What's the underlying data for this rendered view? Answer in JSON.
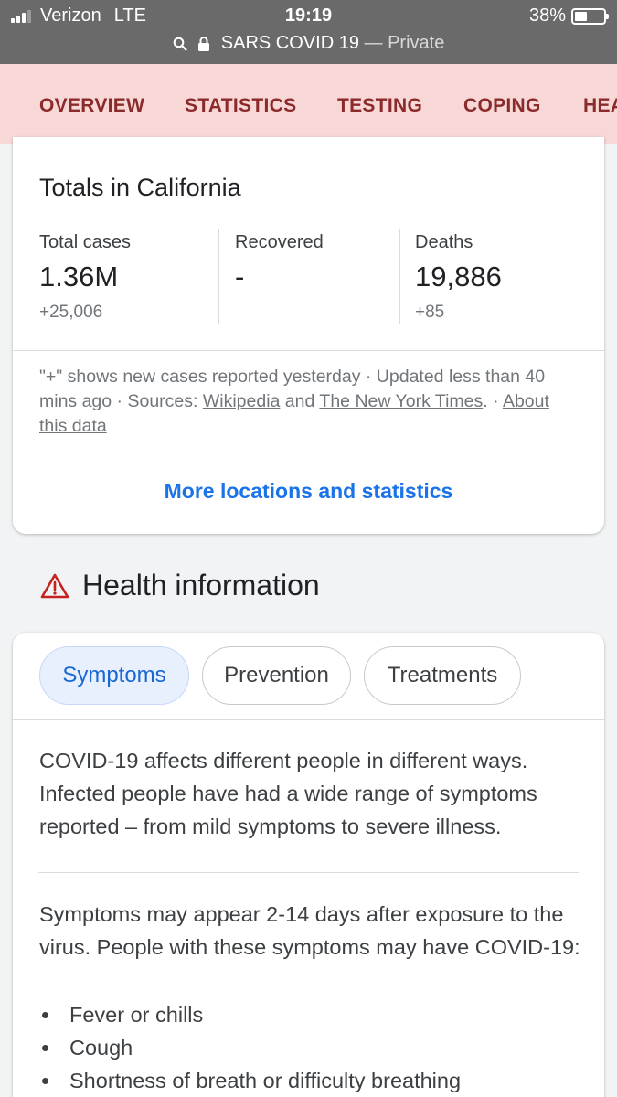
{
  "status_bar": {
    "carrier": "Verizon",
    "network": "LTE",
    "time": "19:19",
    "battery": "38%",
    "battery_level": 0.38
  },
  "url_bar": {
    "title": "SARS COVID 19",
    "separator": "—",
    "mode": "Private"
  },
  "tabs": [
    {
      "label": "OVERVIEW",
      "active": true
    },
    {
      "label": "STATISTICS"
    },
    {
      "label": "TESTING"
    },
    {
      "label": "COPING"
    },
    {
      "label": "HEA"
    }
  ],
  "totals": {
    "title": "Totals in California",
    "stats": [
      {
        "label": "Total cases",
        "value": "1.36M",
        "delta": "+25,006"
      },
      {
        "label": "Recovered",
        "value": "-",
        "delta": ""
      },
      {
        "label": "Deaths",
        "value": "19,886",
        "delta": "+85"
      }
    ],
    "footnote": {
      "line1": "\"+\" shows new cases reported yesterday · Updated less than 40 mins ago",
      "sep": " · ",
      "sources_prefix": "Sources: ",
      "source1": "Wikipedia",
      "and": " and ",
      "source2": "The New York Times",
      "period": ".",
      "about": "About this data"
    },
    "more_link": "More locations and statistics"
  },
  "health": {
    "title": "Health information",
    "icon": "warning-icon",
    "chips": [
      "Symptoms",
      "Prevention",
      "Treatments"
    ],
    "intro": "COVID-19 affects different people in different ways. Infected people have had a wide range of symptoms reported – from mild symptoms to severe illness.",
    "symptoms_intro": "Symptoms may appear 2-14 days after exposure to the virus. People with these symptoms may have COVID-19:",
    "symptoms": [
      "Fever or chills",
      "Cough",
      "Shortness of breath or difficulty breathing"
    ]
  },
  "colors": {
    "accent_blue": "#1a73e8",
    "tab_bg": "#f8d7d7",
    "tab_text": "#8b2a2a",
    "tab_indicator": "#c5221f"
  }
}
